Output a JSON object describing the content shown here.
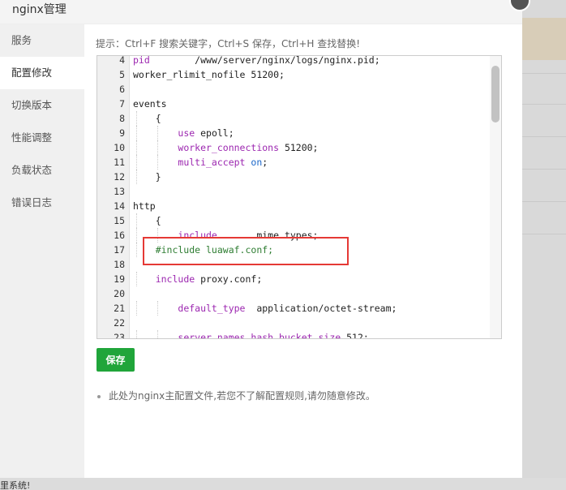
{
  "modal": {
    "title": "nginx管理",
    "hint": "提示：Ctrl+F 搜索关键字，Ctrl+S 保存，Ctrl+H 查找替换!",
    "save_label": "保存",
    "note": "此处为nginx主配置文件,若您不了解配置规则,请勿随意修改。"
  },
  "sidebar": {
    "items": [
      {
        "label": "服务"
      },
      {
        "label": "配置修改"
      },
      {
        "label": "切换版本"
      },
      {
        "label": "性能调整"
      },
      {
        "label": "负载状态"
      },
      {
        "label": "错误日志"
      }
    ]
  },
  "editor": {
    "lines": [
      {
        "n": "4",
        "text": "pid        /www/server/nginx/logs/nginx.pid;"
      },
      {
        "n": "5",
        "text": "worker_rlimit_nofile 51200;"
      },
      {
        "n": "6",
        "text": ""
      },
      {
        "n": "7",
        "text": "events"
      },
      {
        "n": "8",
        "text": "    {"
      },
      {
        "n": "9",
        "text": "        use epoll;"
      },
      {
        "n": "10",
        "text": "        worker_connections 51200;"
      },
      {
        "n": "11",
        "text": "        multi_accept on;"
      },
      {
        "n": "12",
        "text": "    }"
      },
      {
        "n": "13",
        "text": ""
      },
      {
        "n": "14",
        "text": "http"
      },
      {
        "n": "15",
        "text": "    {"
      },
      {
        "n": "16",
        "text": "        include       mime.types;"
      },
      {
        "n": "17",
        "text": "    #include luawaf.conf;"
      },
      {
        "n": "18",
        "text": ""
      },
      {
        "n": "19",
        "text": "    include proxy.conf;"
      },
      {
        "n": "20",
        "text": ""
      },
      {
        "n": "21",
        "text": "        default_type  application/octet-stream;"
      },
      {
        "n": "22",
        "text": ""
      },
      {
        "n": "23",
        "text": "        server_names_hash_bucket_size 512;"
      }
    ]
  },
  "background": {
    "bottom_text": "里系统!"
  },
  "colors": {
    "accent_green": "#20a53a",
    "highlight_red": "#e53935"
  }
}
